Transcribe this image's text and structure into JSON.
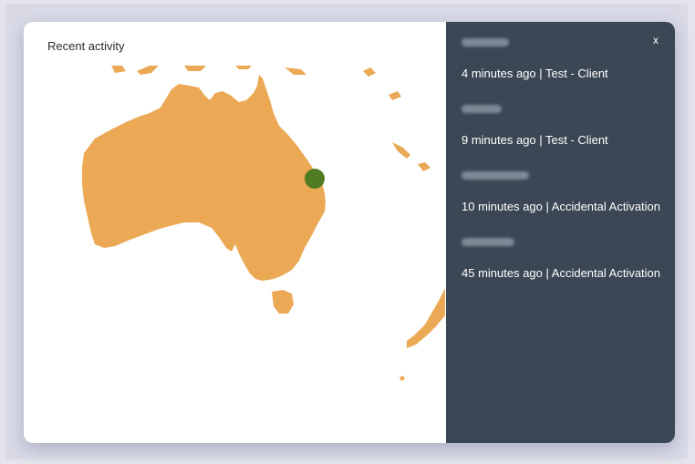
{
  "card": {
    "title": "Recent activity"
  },
  "panel": {
    "close_label": "x",
    "items": [
      {
        "description": "4 minutes ago | Test - Client"
      },
      {
        "description": "9 minutes ago | Test - Client"
      },
      {
        "description": "10 minutes ago | Accidental Activation"
      },
      {
        "description": "45 minutes ago | Accidental Activation"
      }
    ]
  },
  "colors": {
    "land": "#eba956",
    "marker": "#4f7b23",
    "panel_bg": "#3b4754"
  },
  "map": {
    "marker_icon": "location-dot-icon"
  }
}
